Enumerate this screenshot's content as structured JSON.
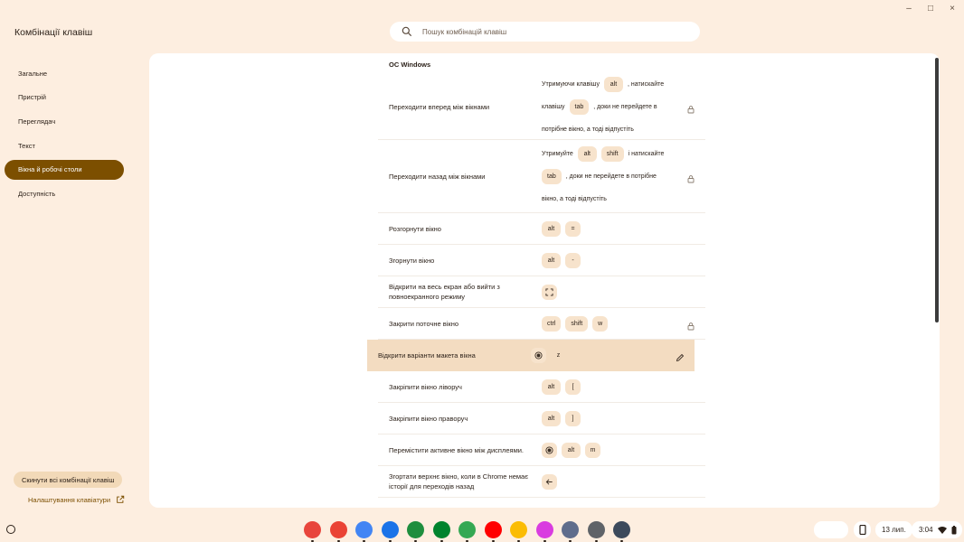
{
  "app": {
    "title": "Комбінації клавіш",
    "window_controls": [
      "–",
      "□",
      "×"
    ]
  },
  "search": {
    "placeholder": "Пошук комбінацій клавіш",
    "icon": "search-icon"
  },
  "sidebar": {
    "items": [
      {
        "label": "Загальне",
        "active": false
      },
      {
        "label": "Пристрій",
        "active": false
      },
      {
        "label": "Переглядач",
        "active": false
      },
      {
        "label": "Текст",
        "active": false
      },
      {
        "label": "Вікна й робочі столи",
        "active": true
      },
      {
        "label": "Доступність",
        "active": false
      }
    ],
    "reset_label": "Скинути всі комбінації клавіш",
    "keyboard_settings_label": "Налаштування клавіатури"
  },
  "main": {
    "section_title": "ОС Windows",
    "rows": [
      {
        "label": "Переходити вперед між вікнами",
        "lines": [
          [
            {
              "t": "Утримуючи клавішу"
            },
            {
              "k": "alt"
            },
            {
              "t": ", натискайте"
            }
          ],
          [
            {
              "t": "клавішу"
            },
            {
              "k": "tab"
            },
            {
              "t": ", доки не перейдете в"
            }
          ],
          [
            {
              "t": "потрібне вікно, а тоді відпустіть"
            }
          ]
        ],
        "trail": "lock-icon"
      },
      {
        "label": "Переходити назад між вікнами",
        "lines": [
          [
            {
              "t": "Утримуйте"
            },
            {
              "k": "alt"
            },
            {
              "k": "shift"
            },
            {
              "t": "і натискайте"
            }
          ],
          [
            {
              "k": "tab"
            },
            {
              "t": ", доки не перейдете в потрібне"
            }
          ],
          [
            {
              "t": "вікно, а тоді відпустіть"
            }
          ]
        ],
        "trail": "lock-icon"
      },
      {
        "label": "Розгорнути вікно",
        "keys": [
          "alt",
          "="
        ],
        "trail": ""
      },
      {
        "label": "Згорнути вікно",
        "keys": [
          "alt",
          "-"
        ],
        "trail": ""
      },
      {
        "label": "Відкрити на весь екран або вийти з повноекранного режиму",
        "keys": [
          "fullscreen-icon"
        ],
        "trail": ""
      },
      {
        "label": "Закрити поточне вікно",
        "keys": [
          "ctrl",
          "shift",
          "w"
        ],
        "trail": "lock-icon"
      },
      {
        "label": "Відкрити варіанти макета вікна",
        "keys": [
          "launcher-key-icon",
          "z"
        ],
        "trail": "pencil-icon",
        "highlight": true
      },
      {
        "label": "Закріпити вікно ліворуч",
        "keys": [
          "alt",
          "["
        ],
        "trail": ""
      },
      {
        "label": "Закріпити вікно праворуч",
        "keys": [
          "alt",
          "]"
        ],
        "trail": ""
      },
      {
        "label": "Перемістити активне вікно між дисплеями.",
        "keys": [
          "launcher-key-icon",
          "alt",
          "m"
        ],
        "trail": ""
      },
      {
        "label": "Згортати верхнє вікно, коли в Chrome немає історії для переходів назад",
        "keys": [
          "back-arrow-icon"
        ],
        "trail": ""
      }
    ]
  },
  "shelf": {
    "apps": [
      {
        "name": "chrome-icon",
        "color": "#e8453c"
      },
      {
        "name": "gmail-icon",
        "color": "#ea4335"
      },
      {
        "name": "docs-icon",
        "color": "#4285f4"
      },
      {
        "name": "files-icon",
        "color": "#1a73e8"
      },
      {
        "name": "chat-icon",
        "color": "#1e8e3e"
      },
      {
        "name": "meet-icon",
        "color": "#00832d"
      },
      {
        "name": "play-store-icon",
        "color": "#34a853"
      },
      {
        "name": "youtube-icon",
        "color": "#ff0000"
      },
      {
        "name": "photos-icon",
        "color": "#fbbc04"
      },
      {
        "name": "screencast-icon",
        "color": "#d93ce0"
      },
      {
        "name": "camera-app-icon",
        "color": "#5f6d8c"
      },
      {
        "name": "settings-app-icon",
        "color": "#5f6368"
      },
      {
        "name": "diagnostics-icon",
        "color": "#3c4a5c"
      }
    ],
    "date": "13 лип.",
    "time": "3:04"
  }
}
